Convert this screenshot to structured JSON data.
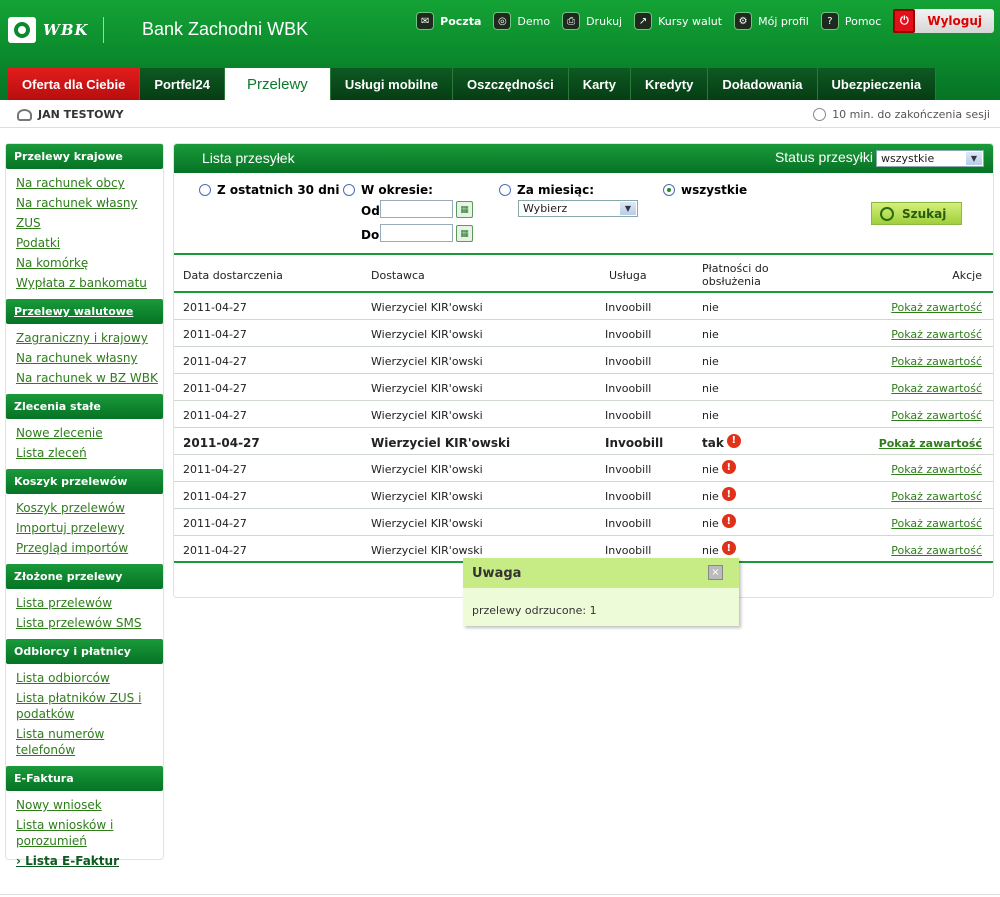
{
  "header": {
    "logo_text": "WBK",
    "bank_name": "Bank Zachodni WBK",
    "toplinks": [
      {
        "label": "Poczta",
        "icon": "mail-icon"
      },
      {
        "label": "Demo",
        "icon": "demo-icon"
      },
      {
        "label": "Drukuj",
        "icon": "print-icon"
      },
      {
        "label": "Kursy walut",
        "icon": "chart-icon"
      },
      {
        "label": "Mój profil",
        "icon": "gear-icon"
      },
      {
        "label": "Pomoc",
        "icon": "help-icon"
      }
    ],
    "logout_label": "Wyloguj"
  },
  "tabs": [
    "Oferta dla Ciebie",
    "Portfel24",
    "Przelewy",
    "Usługi mobilne",
    "Oszczędności",
    "Karty",
    "Kredyty",
    "Doładowania",
    "Ubezpieczenia"
  ],
  "userbar": {
    "user_name": "JAN TESTOWY",
    "session_text": "10 min. do zakończenia sesji"
  },
  "sidebar": {
    "sections": [
      {
        "title": "Przelewy krajowe",
        "items": [
          "Na rachunek obcy",
          "Na rachunek własny",
          "ZUS",
          "Podatki",
          "Na komórkę",
          "Wypłata z bankomatu"
        ]
      },
      {
        "title": "Przelewy walutowe",
        "items": [
          "Zagraniczny i krajowy",
          "Na rachunek własny",
          "Na rachunek w BZ WBK"
        ]
      },
      {
        "title": "Zlecenia stałe",
        "items": [
          "Nowe zlecenie",
          "Lista zleceń"
        ]
      },
      {
        "title": "Koszyk przelewów",
        "items": [
          "Koszyk przelewów",
          "Importuj przelewy",
          "Przegląd importów"
        ]
      },
      {
        "title": "Złożone przelewy",
        "items": [
          "Lista przelewów",
          "Lista przelewów SMS"
        ]
      },
      {
        "title": "Odbiorcy i płatnicy",
        "items": [
          "Lista odbiorców",
          "Lista płatników ZUS i podatków",
          "Lista numerów telefonów"
        ]
      },
      {
        "title": "E-Faktura",
        "items": [
          "Nowy wniosek",
          "Lista wniosków i porozumień",
          "Lista E-Faktur"
        ]
      }
    ]
  },
  "panel": {
    "title": "Lista przesyłek",
    "status_label": "Status przesyłki",
    "status_value": "wszystkie",
    "filters": {
      "last30": "Z ostatnich 30 dni",
      "period": "W okresie:",
      "from": "Od",
      "to": "Do",
      "month": "Za miesiąc:",
      "month_value": "Wybierz",
      "all": "wszystkie"
    },
    "search_label": "Szukaj",
    "columns": {
      "date": "Data dostarczenia",
      "supplier": "Dostawca",
      "service": "Usługa",
      "payments_line1": "Płatności do",
      "payments_line2": "obsłużenia",
      "actions": "Akcje"
    },
    "rows": [
      {
        "date": "2011-04-27",
        "supplier": "Wierzyciel KIR'owski",
        "service": "Invoobill",
        "payments": "nie",
        "action": "Pokaż zawartość"
      },
      {
        "date": "2011-04-27",
        "supplier": "Wierzyciel KIR'owski",
        "service": "Invoobill",
        "payments": "nie",
        "action": "Pokaż zawartość"
      },
      {
        "date": "2011-04-27",
        "supplier": "Wierzyciel KIR'owski",
        "service": "Invoobill",
        "payments": "nie",
        "action": "Pokaż zawartość"
      },
      {
        "date": "2011-04-27",
        "supplier": "Wierzyciel KIR'owski",
        "service": "Invoobill",
        "payments": "nie",
        "action": "Pokaż zawartość"
      },
      {
        "date": "2011-04-27",
        "supplier": "Wierzyciel KIR'owski",
        "service": "Invoobill",
        "payments": "nie",
        "action": "Pokaż zawartość"
      },
      {
        "date": "2011-04-27",
        "supplier": "Wierzyciel KIR'owski",
        "service": "Invoobill",
        "payments": "tak",
        "action": "Pokaż zawartość"
      },
      {
        "date": "2011-04-27",
        "supplier": "Wierzyciel KIR'owski",
        "service": "Invoobill",
        "payments": "nie",
        "action": "Pokaż zawartość"
      },
      {
        "date": "2011-04-27",
        "supplier": "Wierzyciel KIR'owski",
        "service": "Invoobill",
        "payments": "nie",
        "action": "Pokaż zawartość"
      },
      {
        "date": "2011-04-27",
        "supplier": "Wierzyciel KIR'owski",
        "service": "Invoobill",
        "payments": "nie",
        "action": "Pokaż zawartość"
      },
      {
        "date": "2011-04-27",
        "supplier": "Wierzyciel KIR'owski",
        "service": "Invoobill",
        "payments": "nie",
        "action": "Pokaż zawartość"
      }
    ]
  },
  "popup": {
    "title": "Uwaga",
    "close": "×",
    "message": "przelewy odrzucone: 1"
  }
}
